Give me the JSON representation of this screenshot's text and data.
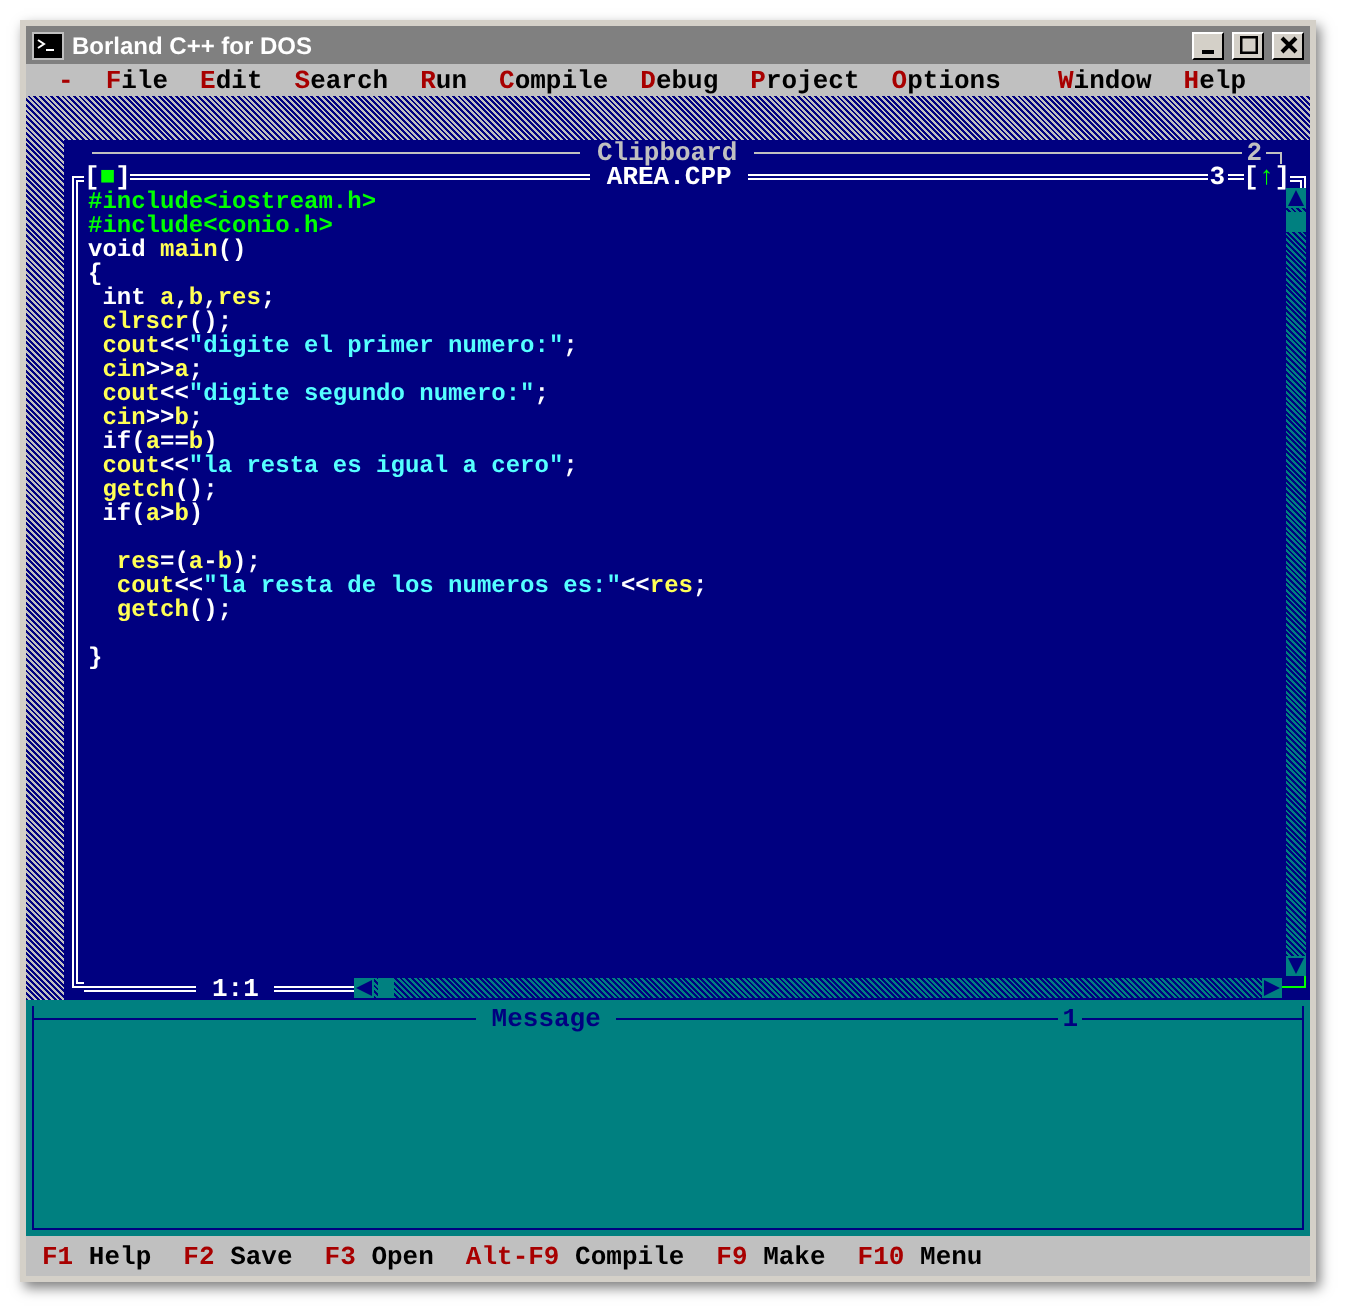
{
  "window": {
    "title": "Borland C++ for DOS"
  },
  "menu": {
    "left": [
      {
        "hotkey": "-"
      },
      {
        "hotkey": "F",
        "rest": "ile"
      },
      {
        "hotkey": "E",
        "rest": "dit"
      },
      {
        "hotkey": "S",
        "rest": "earch"
      },
      {
        "hotkey": "R",
        "rest": "un"
      },
      {
        "hotkey": "C",
        "rest": "ompile"
      },
      {
        "hotkey": "D",
        "rest": "ebug"
      },
      {
        "hotkey": "P",
        "rest": "roject"
      },
      {
        "hotkey": "O",
        "rest": "ptions"
      }
    ],
    "right": [
      {
        "hotkey": "W",
        "rest": "indow"
      },
      {
        "hotkey": "H",
        "rest": "elp"
      }
    ]
  },
  "clipboard": {
    "title": "Clipboard",
    "number": "2"
  },
  "editor": {
    "title": "AREA.CPP",
    "number": "3",
    "close_box": {
      "open": "[",
      "glyph": "■",
      "close": "]"
    },
    "zoom_box": {
      "open": "[",
      "glyph": "↑",
      "close": "]"
    },
    "position": "1:1",
    "lines": [
      {
        "segments": [
          {
            "text": "#include<iostream.h>",
            "kind": "directive"
          }
        ]
      },
      {
        "segments": [
          {
            "text": "#include<conio.h>",
            "kind": "directive"
          }
        ]
      },
      {
        "segments": [
          {
            "text": "void ",
            "kind": "keyword"
          },
          {
            "text": "main",
            "kind": "ident"
          },
          {
            "text": "()",
            "kind": "keyword"
          }
        ]
      },
      {
        "segments": [
          {
            "text": "{",
            "kind": "keyword"
          }
        ]
      },
      {
        "segments": [
          {
            "text": " int ",
            "kind": "keyword"
          },
          {
            "text": "a",
            "kind": "ident"
          },
          {
            "text": ",",
            "kind": "keyword"
          },
          {
            "text": "b",
            "kind": "ident"
          },
          {
            "text": ",",
            "kind": "keyword"
          },
          {
            "text": "res",
            "kind": "ident"
          },
          {
            "text": ";",
            "kind": "keyword"
          }
        ]
      },
      {
        "segments": [
          {
            "text": " clrscr",
            "kind": "ident"
          },
          {
            "text": "();",
            "kind": "keyword"
          }
        ]
      },
      {
        "segments": [
          {
            "text": " cout",
            "kind": "ident"
          },
          {
            "text": "<<",
            "kind": "keyword"
          },
          {
            "text": "\"digite el primer numero:\"",
            "kind": "string"
          },
          {
            "text": ";",
            "kind": "keyword"
          }
        ]
      },
      {
        "segments": [
          {
            "text": " cin",
            "kind": "ident"
          },
          {
            "text": ">>",
            "kind": "keyword"
          },
          {
            "text": "a",
            "kind": "ident"
          },
          {
            "text": ";",
            "kind": "keyword"
          }
        ]
      },
      {
        "segments": [
          {
            "text": " cout",
            "kind": "ident"
          },
          {
            "text": "<<",
            "kind": "keyword"
          },
          {
            "text": "\"digite segundo numero:\"",
            "kind": "string"
          },
          {
            "text": ";",
            "kind": "keyword"
          }
        ]
      },
      {
        "segments": [
          {
            "text": " cin",
            "kind": "ident"
          },
          {
            "text": ">>",
            "kind": "keyword"
          },
          {
            "text": "b",
            "kind": "ident"
          },
          {
            "text": ";",
            "kind": "keyword"
          }
        ]
      },
      {
        "segments": [
          {
            "text": " if(",
            "kind": "keyword"
          },
          {
            "text": "a",
            "kind": "ident"
          },
          {
            "text": "==",
            "kind": "keyword"
          },
          {
            "text": "b",
            "kind": "ident"
          },
          {
            "text": ")",
            "kind": "keyword"
          }
        ]
      },
      {
        "segments": [
          {
            "text": " cout",
            "kind": "ident"
          },
          {
            "text": "<<",
            "kind": "keyword"
          },
          {
            "text": "\"la resta es igual a cero\"",
            "kind": "string"
          },
          {
            "text": ";",
            "kind": "keyword"
          }
        ]
      },
      {
        "segments": [
          {
            "text": " getch",
            "kind": "ident"
          },
          {
            "text": "();",
            "kind": "keyword"
          }
        ]
      },
      {
        "segments": [
          {
            "text": " if(",
            "kind": "keyword"
          },
          {
            "text": "a",
            "kind": "ident"
          },
          {
            "text": ">",
            "kind": "keyword"
          },
          {
            "text": "b",
            "kind": "ident"
          },
          {
            "text": ")",
            "kind": "keyword"
          }
        ]
      },
      {
        "blank_before": true,
        "segments": [
          {
            "text": "  res",
            "kind": "ident"
          },
          {
            "text": "=(",
            "kind": "keyword"
          },
          {
            "text": "a",
            "kind": "ident"
          },
          {
            "text": "-",
            "kind": "keyword"
          },
          {
            "text": "b",
            "kind": "ident"
          },
          {
            "text": ");",
            "kind": "keyword"
          }
        ]
      },
      {
        "segments": [
          {
            "text": "  cout",
            "kind": "ident"
          },
          {
            "text": "<<",
            "kind": "keyword"
          },
          {
            "text": "\"la resta de los numeros es:\"",
            "kind": "string"
          },
          {
            "text": "<<",
            "kind": "keyword"
          },
          {
            "text": "res",
            "kind": "ident"
          },
          {
            "text": ";",
            "kind": "keyword"
          }
        ]
      },
      {
        "segments": [
          {
            "text": "  getch",
            "kind": "ident"
          },
          {
            "text": "();",
            "kind": "keyword"
          }
        ]
      },
      {
        "blank_before": true,
        "segments": [
          {
            "text": "}",
            "kind": "keyword"
          }
        ]
      }
    ]
  },
  "message": {
    "title": "Message",
    "number": "1"
  },
  "status_bar": [
    {
      "key": "F1",
      "label": "Help"
    },
    {
      "key": "F2",
      "label": "Save"
    },
    {
      "key": "F3",
      "label": "Open"
    },
    {
      "key": "Alt-F9",
      "label": "Compile"
    },
    {
      "key": "F9",
      "label": "Make"
    },
    {
      "key": "F10",
      "label": "Menu"
    }
  ]
}
